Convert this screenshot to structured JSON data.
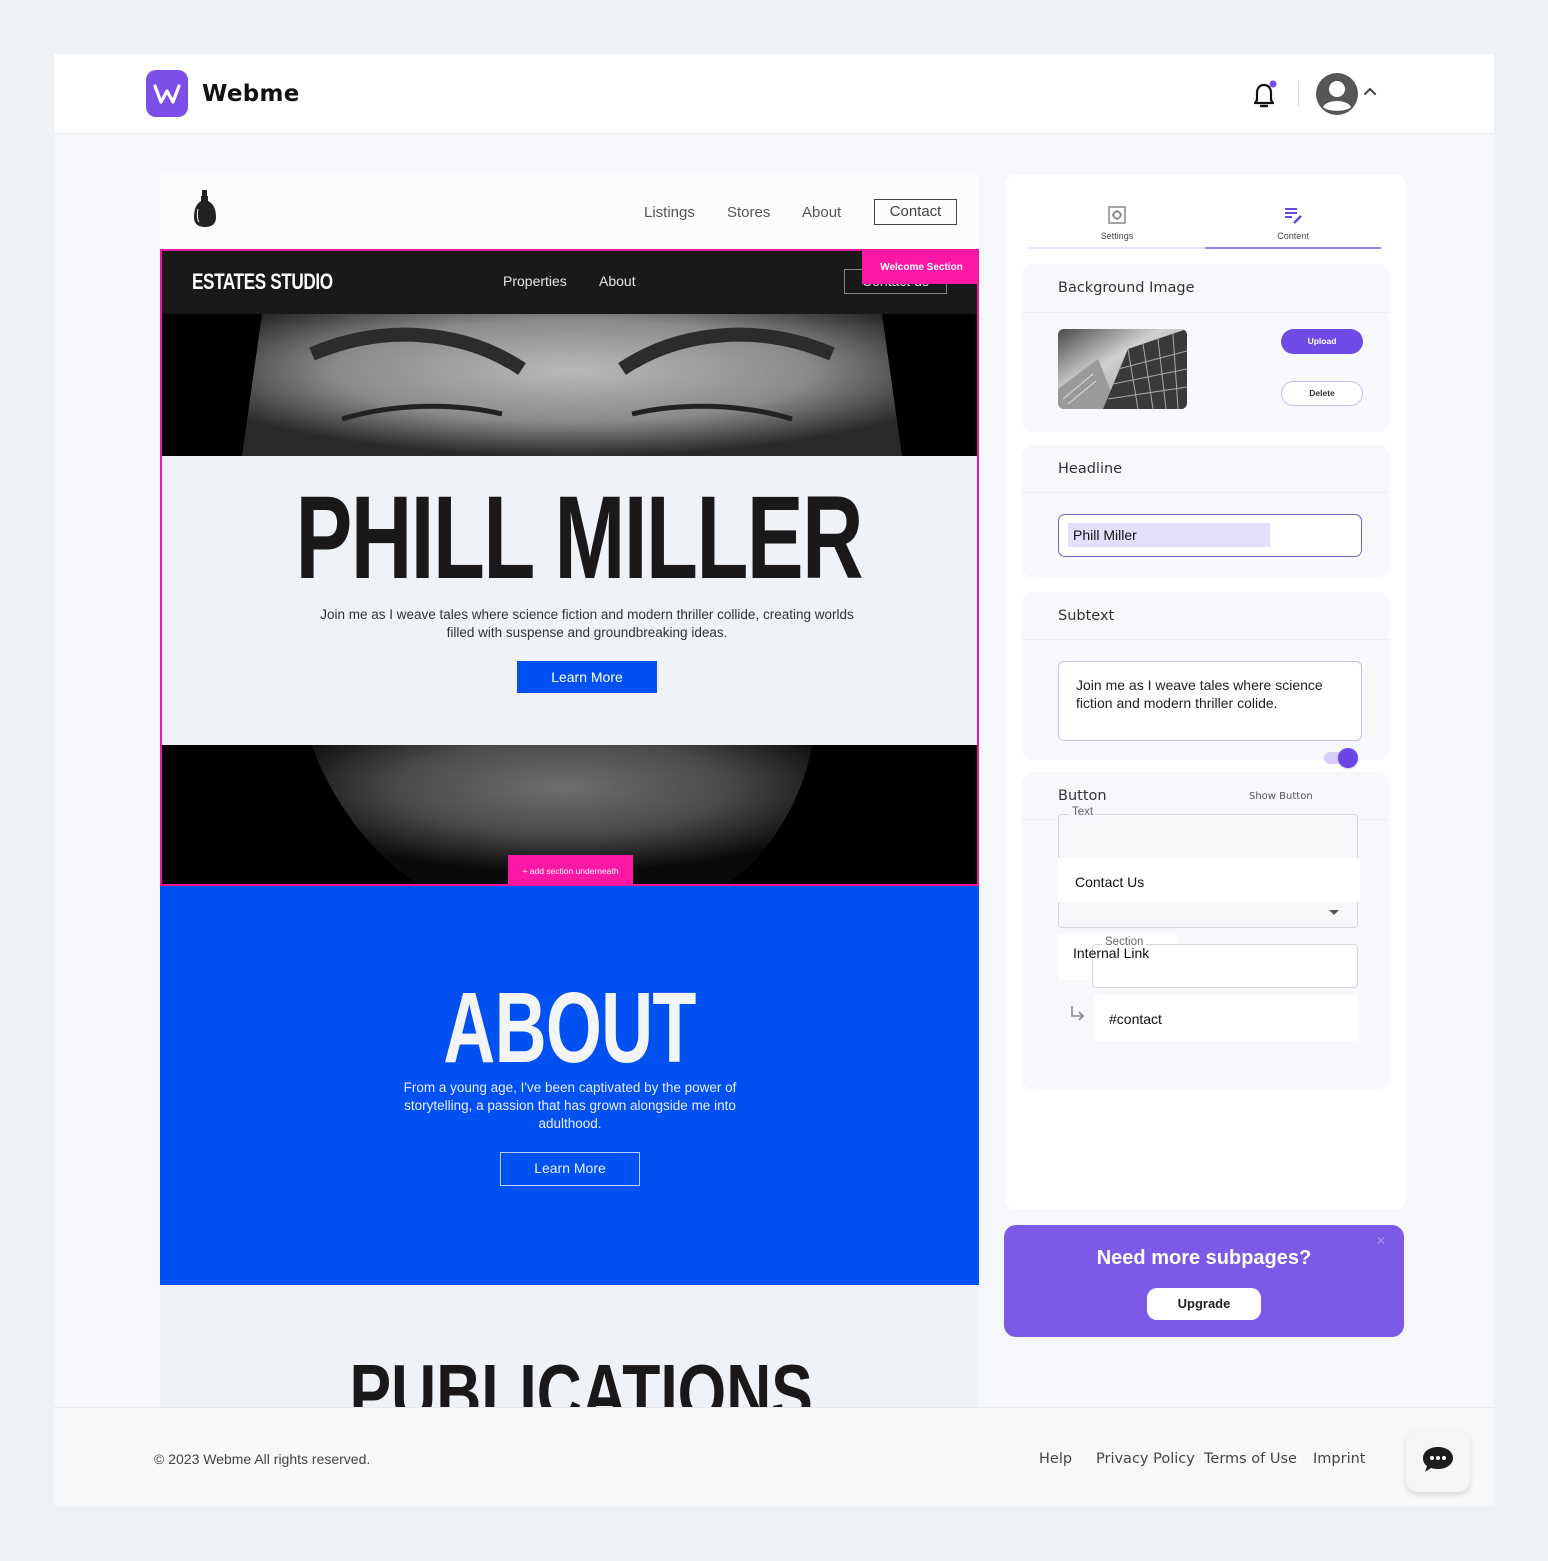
{
  "app": {
    "brand": "Webme",
    "logo_letter": "W",
    "accent_color": "#7b4fe8",
    "notification_dot": true
  },
  "preview": {
    "nav": {
      "links": [
        "Listings",
        "Stores",
        "About"
      ],
      "contact": "Contact"
    },
    "welcome_section": {
      "badge": "Welcome Section",
      "site_name": "ESTATES STUDIO",
      "links": [
        "Properties",
        "About"
      ],
      "contact": "Contact us",
      "headline": "PHILL MILLER",
      "subtext": "Join me as I weave tales where science fiction and modern thriller collide, creating worlds filled with suspense and groundbreaking ideas.",
      "button": "Learn More",
      "add_section": "add section underneath",
      "highlight_color": "#fc17a4"
    },
    "about_section": {
      "title": "ABOUT",
      "text": "From a young age, I've been captivated by the power of storytelling, a passion that has grown alongside me into adulthood.",
      "button": "Learn More",
      "bg_color": "#0050f2"
    },
    "publications_section": {
      "title": "PUBLICATIONS"
    }
  },
  "panel": {
    "tabs": [
      {
        "label": "Settings",
        "icon": "settings-icon",
        "active": false
      },
      {
        "label": "Content",
        "icon": "edit-content-icon",
        "active": true
      }
    ],
    "background_image": {
      "title": "Background Image",
      "upload": "Upload",
      "delete": "Delete"
    },
    "headline": {
      "title": "Headline",
      "value": "Phill Miller"
    },
    "subtext": {
      "title": "Subtext",
      "value": "Join me as I weave tales where science fiction and modern thriller colide.",
      "toggle_on": true
    },
    "button": {
      "title": "Button",
      "show_label": "Show Button",
      "text_legend": "Text",
      "text_value": "Contact Us",
      "link_type": "Internal Link",
      "section_legend": "Section",
      "section_value": "#contact"
    }
  },
  "promo": {
    "title": "Need more subpages?",
    "button": "Upgrade",
    "close": "×"
  },
  "footer": {
    "copyright": "© 2023 Webme All rights reserved.",
    "links": [
      "Help",
      "Privacy Policy",
      "Terms of Use",
      "Imprint"
    ]
  }
}
